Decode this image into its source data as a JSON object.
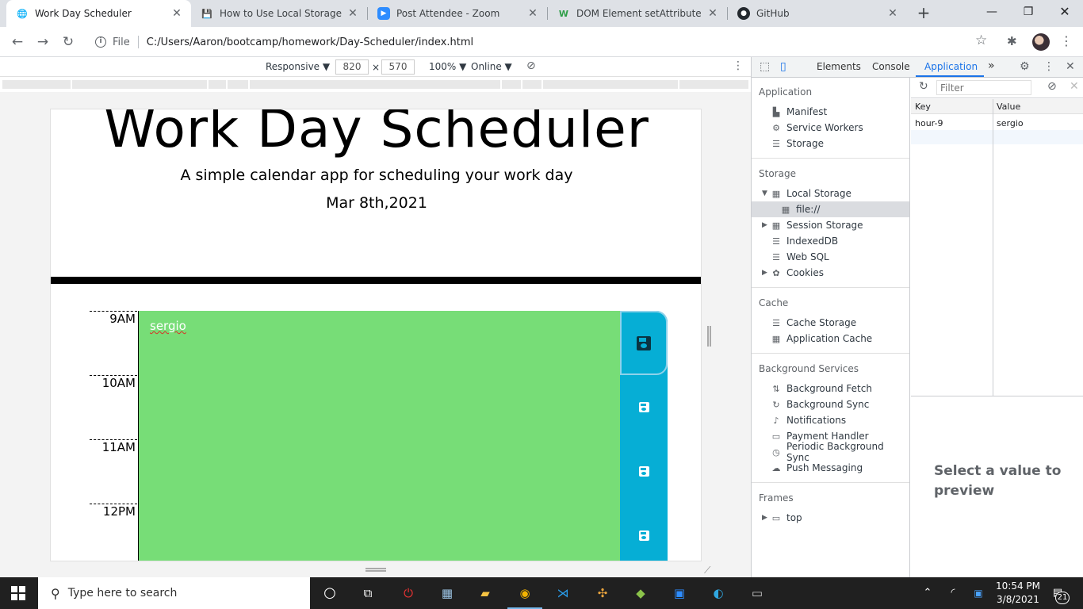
{
  "browser": {
    "tabs": [
      {
        "title": "Work Day Scheduler",
        "active": true
      },
      {
        "title": "How to Use Local Storage with M"
      },
      {
        "title": "Post Attendee - Zoom"
      },
      {
        "title": "DOM Element setAttribute() M"
      },
      {
        "title": "GitHub"
      }
    ],
    "address": {
      "scheme": "File",
      "url": "C:/Users/Aaron/bootcamp/homework/Day-Scheduler/index.html"
    }
  },
  "device_toolbar": {
    "mode": "Responsive ▼",
    "width": "820",
    "height": "570",
    "zoom": "100% ▼",
    "network": "Online ▼",
    "times": "×"
  },
  "page": {
    "title": "Work Day Scheduler",
    "lead": "A simple calendar app for scheduling your work day",
    "current_day": "Mar 8th,2021",
    "hours": [
      "9AM",
      "10AM",
      "11AM",
      "12PM"
    ],
    "entry": "sergio"
  },
  "devtools": {
    "tabs": [
      "Elements",
      "Console",
      "Application",
      "»"
    ],
    "sections": {
      "application": {
        "header": "Application",
        "items": [
          "Manifest",
          "Service Workers",
          "Storage"
        ]
      },
      "storage": {
        "header": "Storage",
        "items": [
          "Local Storage",
          "file://",
          "Session Storage",
          "IndexedDB",
          "Web SQL",
          "Cookies"
        ]
      },
      "cache": {
        "header": "Cache",
        "items": [
          "Cache Storage",
          "Application Cache"
        ]
      },
      "background": {
        "header": "Background Services",
        "items": [
          "Background Fetch",
          "Background Sync",
          "Notifications",
          "Payment Handler",
          "Periodic Background Sync",
          "Push Messaging"
        ]
      },
      "frames": {
        "header": "Frames",
        "items": [
          "top"
        ]
      }
    },
    "filter_placeholder": "Filter",
    "table": {
      "headers": [
        "Key",
        "Value"
      ],
      "rows": [
        [
          "hour-9",
          "sergio"
        ]
      ]
    },
    "preview_text": "Select a value to preview"
  },
  "taskbar": {
    "search_placeholder": "Type here to search",
    "time": "10:54 PM",
    "date": "3/8/2021",
    "notifications": "21"
  }
}
